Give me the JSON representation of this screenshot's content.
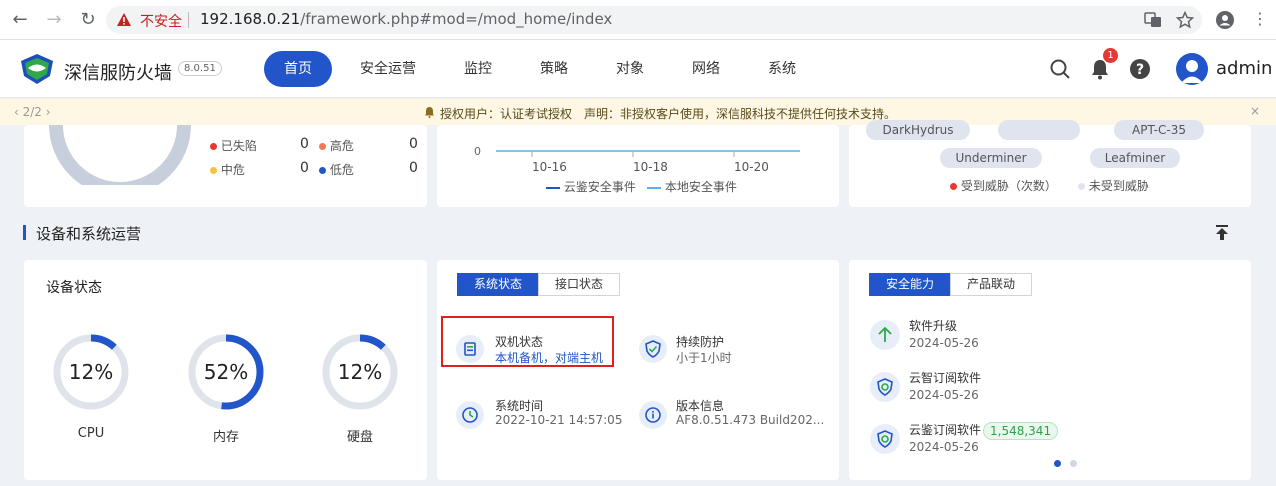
{
  "browser": {
    "security_label": "不安全",
    "url_host": "192.168.0.21",
    "url_path": "/framework.php#mod=/mod_home/index"
  },
  "header": {
    "brand": "深信服防火墙",
    "version": "8.0.51",
    "nav": [
      "首页",
      "安全运营",
      "监控",
      "策略",
      "对象",
      "网络",
      "系统"
    ],
    "active_nav": "首页",
    "notification_count": "1",
    "username": "admin"
  },
  "notice": {
    "pager": "2/2",
    "text": "授权用户：认证考试授权　声明：非授权客户使用，深信服科技不提供任何技术支持。",
    "close": "×"
  },
  "risk_card": {
    "items": [
      {
        "label": "已失陷",
        "value": "0",
        "color": "#e53935"
      },
      {
        "label": "高危",
        "value": "0",
        "color": "#f07a52"
      },
      {
        "label": "中危",
        "value": "0",
        "color": "#f5c242"
      },
      {
        "label": "低危",
        "value": "0",
        "color": "#2155c9"
      }
    ]
  },
  "event_chart": {
    "chart_data": {
      "type": "line",
      "x": [
        "10-16",
        "10-18",
        "10-20"
      ],
      "series": [
        {
          "name": "云鉴安全事件",
          "values": [
            0,
            0,
            0
          ],
          "color": "#2155c9"
        },
        {
          "name": "本地安全事件",
          "values": [
            0,
            0,
            0
          ],
          "color": "#5ab0e8"
        }
      ],
      "y_tick": "0"
    }
  },
  "threat_card": {
    "tags": [
      "DarkHydrus",
      "APT-C-35",
      "Underminer",
      "Leafminer"
    ],
    "legend": [
      {
        "label": "受到威胁（次数）",
        "color": "#e53935"
      },
      {
        "label": "未受到威胁",
        "color": "#dfe4ee"
      }
    ]
  },
  "section": {
    "title": "设备和系统运营"
  },
  "device_status": {
    "title": "设备状态",
    "gauges": [
      {
        "label": "CPU",
        "value": "12%",
        "fraction": 0.12
      },
      {
        "label": "内存",
        "value": "52%",
        "fraction": 0.52
      },
      {
        "label": "硬盘",
        "value": "12%",
        "fraction": 0.12
      }
    ]
  },
  "system_status": {
    "tabs": [
      "系统状态",
      "接口状态"
    ],
    "items": [
      {
        "title": "双机状态",
        "sub": "本机备机，对端主机"
      },
      {
        "title": "持续防护",
        "sub": "小于1小时"
      },
      {
        "title": "系统时间",
        "sub": "2022-10-21 14:57:05"
      },
      {
        "title": "版本信息",
        "sub": "AF8.0.51.473 Build202..."
      }
    ]
  },
  "security_ability": {
    "tabs": [
      "安全能力",
      "产品联动"
    ],
    "items": [
      {
        "title": "软件升级",
        "date": "2024-05-26"
      },
      {
        "title": "云智订阅软件",
        "date": "2024-05-26"
      },
      {
        "title": "云鉴订阅软件",
        "date": "2024-05-26",
        "badge": "1,548,341"
      }
    ]
  }
}
